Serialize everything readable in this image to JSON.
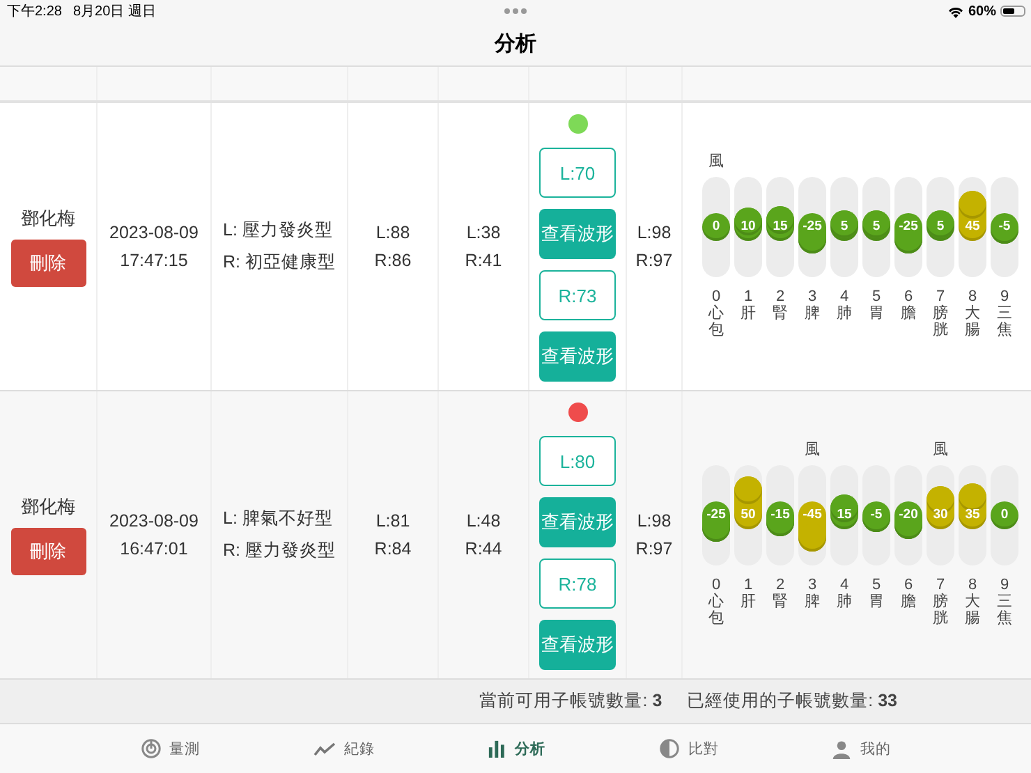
{
  "status_bar": {
    "time": "下午2:28",
    "date": "8月20日 週日",
    "battery": "60%"
  },
  "title": "分析",
  "rows": [
    {
      "name": "鄧化梅",
      "delete_label": "刪除",
      "date": "2023-08-09",
      "time": "17:47:15",
      "types": [
        "L: 壓力發炎型",
        "R: 初亞健康型"
      ],
      "column_4": [
        "L:88",
        "R:86"
      ],
      "column_5": [
        "L:38",
        "R:41"
      ],
      "status_dot": {
        "color": "#7ed957"
      },
      "buttons": [
        {
          "kind": "outline",
          "label": "L:70"
        },
        {
          "kind": "filled",
          "label": "查看波形"
        },
        {
          "kind": "outline",
          "label": "R:73"
        },
        {
          "kind": "filled",
          "label": "查看波形"
        }
      ],
      "column_7": [
        "L:98",
        "R:97"
      ],
      "meridians": [
        {
          "value": "0",
          "level": 0.5,
          "color": "#5aa51c",
          "number": "0",
          "organ": "心包",
          "note": "風"
        },
        {
          "value": "10",
          "level": 0.55,
          "color": "#5aa51c",
          "number": "1",
          "organ": "肝"
        },
        {
          "value": "15",
          "level": 0.575,
          "color": "#5aa51c",
          "number": "2",
          "organ": "腎"
        },
        {
          "value": "-25",
          "level": 0.375,
          "color": "#5aa51c",
          "number": "3",
          "organ": "脾"
        },
        {
          "value": "5",
          "level": 0.525,
          "color": "#5aa51c",
          "number": "4",
          "organ": "肺"
        },
        {
          "value": "5",
          "level": 0.525,
          "color": "#5aa51c",
          "number": "5",
          "organ": "胃"
        },
        {
          "value": "-25",
          "level": 0.375,
          "color": "#5aa51c",
          "number": "6",
          "organ": "膽"
        },
        {
          "value": "5",
          "level": 0.525,
          "color": "#5aa51c",
          "number": "7",
          "organ": "膀胱"
        },
        {
          "value": "45",
          "level": 0.725,
          "color": "#c4b200",
          "number": "8",
          "organ": "大腸"
        },
        {
          "value": "-5",
          "level": 0.475,
          "color": "#5aa51c",
          "number": "9",
          "organ": "三焦"
        }
      ]
    },
    {
      "name": "鄧化梅",
      "delete_label": "刪除",
      "date": "2023-08-09",
      "time": "16:47:01",
      "types": [
        "L: 脾氣不好型",
        "R: 壓力發炎型"
      ],
      "column_4": [
        "L:81",
        "R:84"
      ],
      "column_5": [
        "L:48",
        "R:44"
      ],
      "status_dot": {
        "color": "#ef4c4c"
      },
      "buttons": [
        {
          "kind": "outline",
          "label": "L:80"
        },
        {
          "kind": "filled",
          "label": "查看波形"
        },
        {
          "kind": "outline",
          "label": "R:78"
        },
        {
          "kind": "filled",
          "label": "查看波形"
        }
      ],
      "column_7": [
        "L:98",
        "R:97"
      ],
      "meridians": [
        {
          "value": "-25",
          "level": 0.375,
          "color": "#5aa51c",
          "number": "0",
          "organ": "心包"
        },
        {
          "value": "50",
          "level": 0.75,
          "color": "#c4b200",
          "number": "1",
          "organ": "肝"
        },
        {
          "value": "-15",
          "level": 0.425,
          "color": "#5aa51c",
          "number": "2",
          "organ": "腎"
        },
        {
          "value": "-45",
          "level": 0.275,
          "color": "#c4b200",
          "number": "3",
          "organ": "脾",
          "note": "風"
        },
        {
          "value": "15",
          "level": 0.575,
          "color": "#5aa51c",
          "number": "4",
          "organ": "肺"
        },
        {
          "value": "-5",
          "level": 0.475,
          "color": "#5aa51c",
          "number": "5",
          "organ": "胃"
        },
        {
          "value": "-20",
          "level": 0.4,
          "color": "#5aa51c",
          "number": "6",
          "organ": "膽"
        },
        {
          "value": "30",
          "level": 0.65,
          "color": "#c4b200",
          "number": "7",
          "organ": "膀胱",
          "note": "風"
        },
        {
          "value": "35",
          "level": 0.675,
          "color": "#c4b200",
          "number": "8",
          "organ": "大腸"
        },
        {
          "value": "0",
          "level": 0.5,
          "color": "#5aa51c",
          "number": "9",
          "organ": "三焦"
        }
      ]
    }
  ],
  "footer": [
    "當前可用子帳號數量: **3**",
    "已經使用的子帳號數量: **33**"
  ],
  "tabs": [
    {
      "label": "量測",
      "selected": false
    },
    {
      "label": "紀錄",
      "selected": false
    },
    {
      "label": "分析",
      "selected": true
    },
    {
      "label": "比對",
      "selected": false
    },
    {
      "label": "我的",
      "selected": false
    }
  ]
}
